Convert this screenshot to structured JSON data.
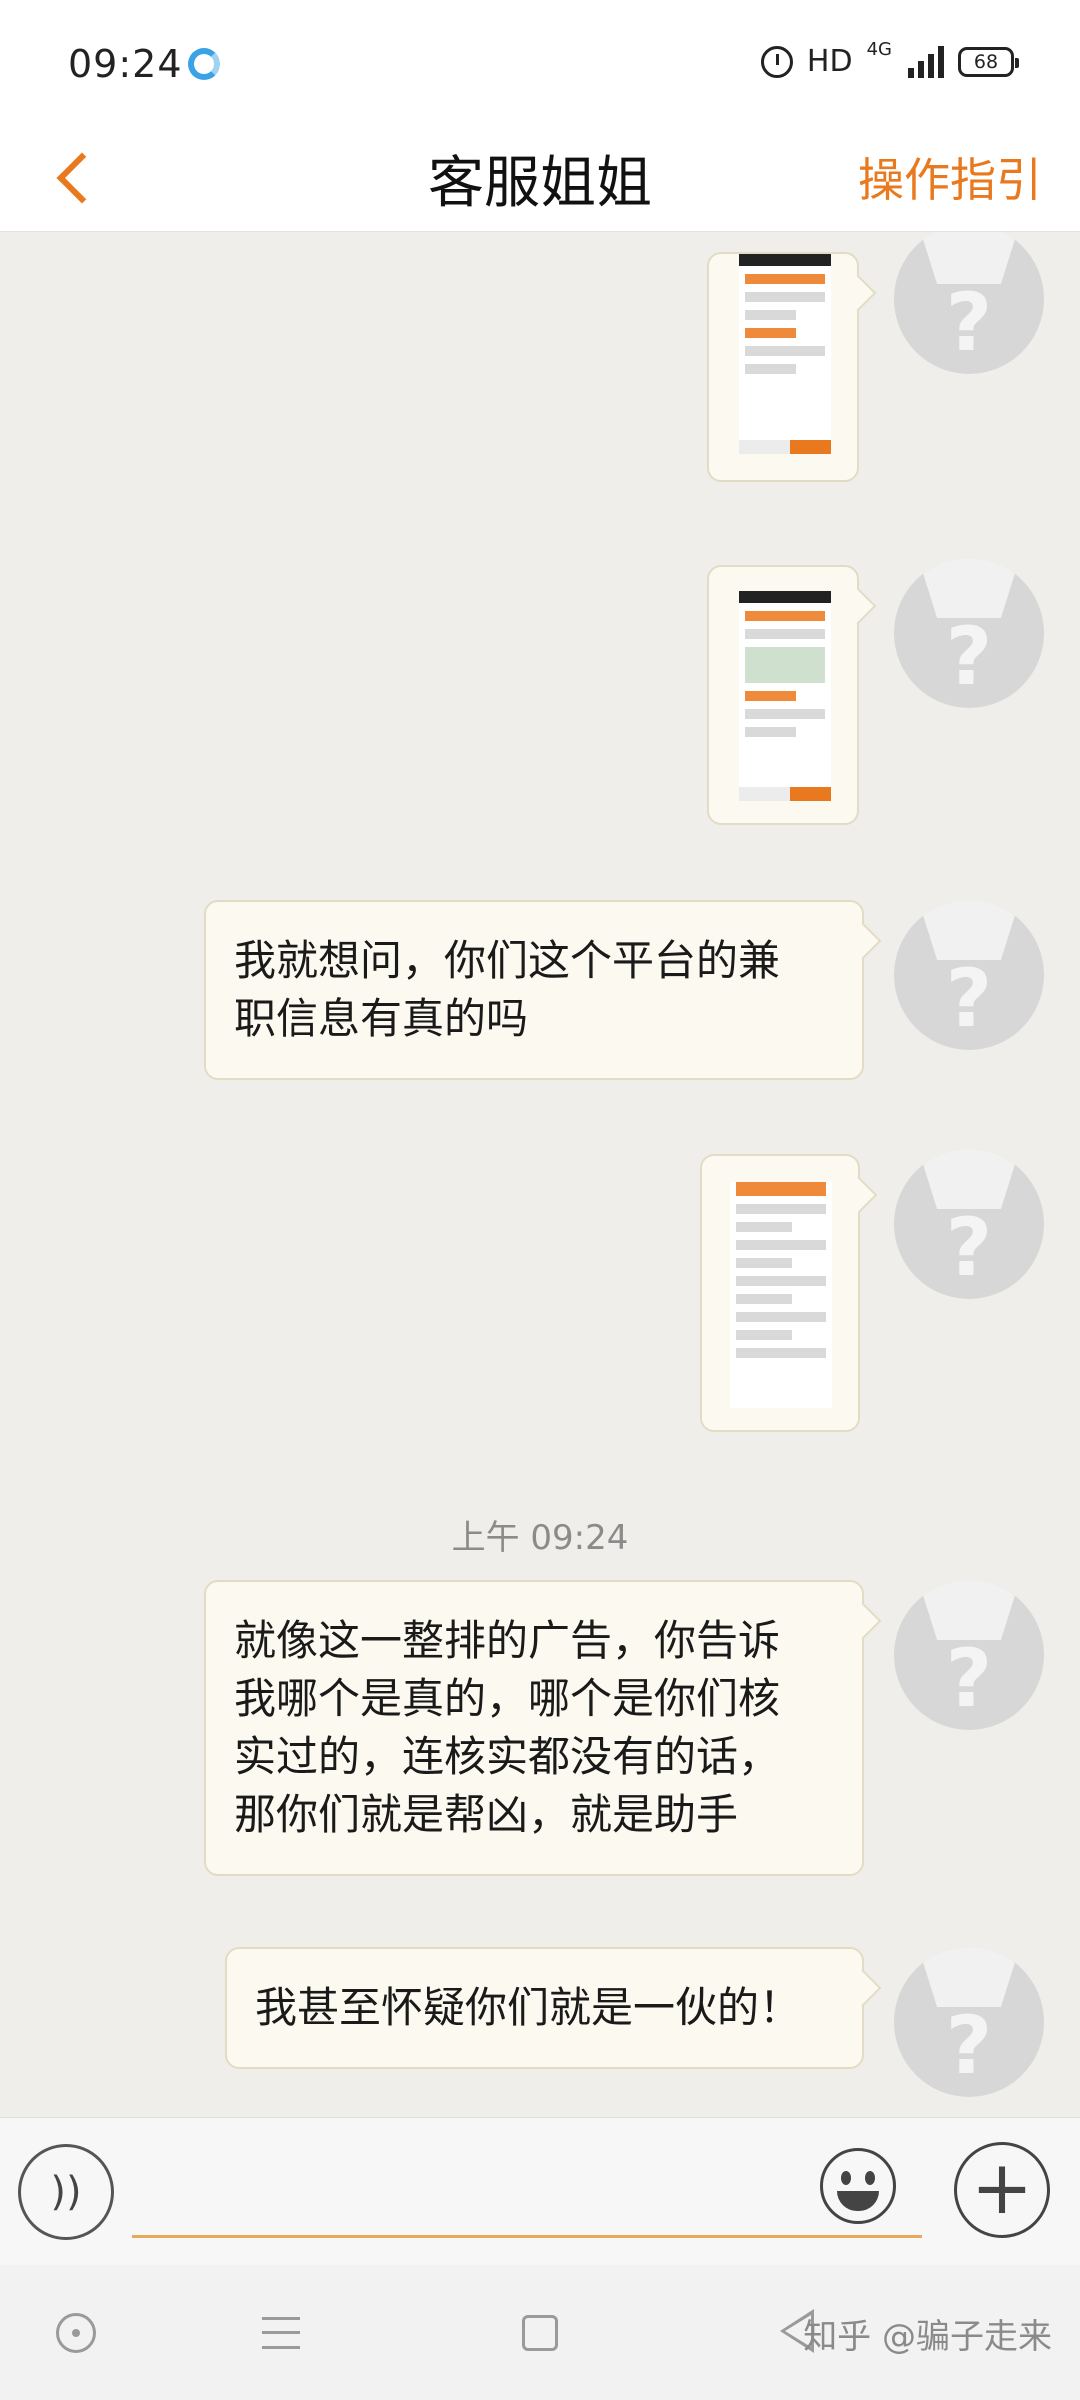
{
  "status_bar": {
    "time": "09:24",
    "hd": "HD",
    "network": "4G",
    "battery": "68",
    "icons": [
      "app-icon",
      "alarm-icon",
      "signal-icon",
      "battery-icon"
    ]
  },
  "header": {
    "back_icon": "chevron-left-icon",
    "title": "客服姐姐",
    "guide": "操作指引"
  },
  "chat": {
    "messages": [
      {
        "type": "image"
      },
      {
        "type": "image"
      },
      {
        "type": "text",
        "lines": [
          "我就想问，你们这个平台的兼",
          "职信息有真的吗"
        ]
      },
      {
        "type": "image"
      },
      {
        "type": "text",
        "lines": [
          "就像这一整排的广告，你告诉",
          "我哪个是真的，哪个是你们核",
          "实过的，连核实都没有的话，",
          "那你们就是帮凶，就是助手"
        ]
      },
      {
        "type": "text",
        "lines": [
          "我甚至怀疑你们就是一伙的！"
        ]
      }
    ],
    "timestamp": "上午 09:24",
    "avatar_glyph": "?"
  },
  "input_bar": {
    "voice_icon": "voice-icon",
    "voice_glyph": "))",
    "emoji_icon": "emoji-icon",
    "plus_icon": "plus-icon",
    "plus_glyph": "+"
  },
  "nav_bar": {
    "icons": [
      "circle-nav-icon",
      "menu-icon",
      "home-square-icon",
      "back-triangle-icon"
    ],
    "watermark": "知乎 @骗子走来"
  },
  "colors": {
    "accent": "#e8791e",
    "bubble": "#fcfaf0",
    "background": "#efeeeb"
  }
}
